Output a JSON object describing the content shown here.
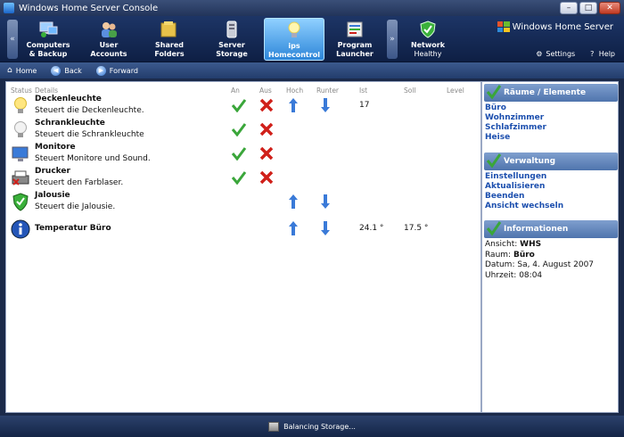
{
  "window": {
    "title": "Windows Home Server Console",
    "minimize_glyph": "–",
    "maximize_glyph": "□",
    "close_glyph": "✕"
  },
  "nav": {
    "left_arrow": "«",
    "right_arrow": "»",
    "tabs": [
      {
        "line1": "Computers",
        "line2": "& Backup",
        "icon": "computers-icon"
      },
      {
        "line1": "User",
        "line2": "Accounts",
        "icon": "user-accounts-icon"
      },
      {
        "line1": "Shared",
        "line2": "Folders",
        "icon": "shared-folders-icon"
      },
      {
        "line1": "Server",
        "line2": "Storage",
        "icon": "server-storage-icon"
      },
      {
        "line1": "ips",
        "line2": "Homecontrol",
        "icon": "lightbulb-icon",
        "active": true
      },
      {
        "line1": "Program",
        "line2": "Launcher",
        "icon": "program-launcher-icon"
      },
      {
        "line1": "Network",
        "line2": "Healthy",
        "icon": "network-shield-icon"
      }
    ],
    "brand": "Windows Home Server",
    "settings_label": "Settings",
    "help_label": "Help"
  },
  "toolbar": {
    "home_label": "Home",
    "back_label": "Back",
    "forward_label": "Forward"
  },
  "table": {
    "headers": {
      "status": "Status",
      "details": "Details",
      "an": "An",
      "aus": "Aus",
      "hoch": "Hoch",
      "runter": "Runter",
      "ist": "Ist",
      "soll": "Soll",
      "level": "Level"
    },
    "rows": [
      {
        "name": "Deckenleuchte",
        "desc": "Steuert die Deckenleuchte.",
        "icon": "bulb-on-icon",
        "an": true,
        "aus": true,
        "hoch": true,
        "runter": true,
        "ist": "17",
        "soll": ""
      },
      {
        "name": "Schrankleuchte",
        "desc": "Steuert die Schrankleuchte",
        "icon": "bulb-off-icon",
        "an": true,
        "aus": true,
        "hoch": false,
        "runter": false,
        "ist": "",
        "soll": ""
      },
      {
        "name": "Monitore",
        "desc": "Steuert Monitore und Sound.",
        "icon": "monitor-icon",
        "an": true,
        "aus": true,
        "hoch": false,
        "runter": false,
        "ist": "",
        "soll": ""
      },
      {
        "name": "Drucker",
        "desc": "Steuert den Farblaser.",
        "icon": "printer-icon",
        "an": true,
        "aus": true,
        "hoch": false,
        "runter": false,
        "ist": "",
        "soll": ""
      },
      {
        "name": "Jalousie",
        "desc": "Steuert die Jalousie.",
        "icon": "shield-check-icon",
        "an": false,
        "aus": false,
        "hoch": true,
        "runter": true,
        "ist": "",
        "soll": ""
      },
      {
        "name": "Temperatur Büro",
        "desc": "",
        "icon": "info-icon",
        "an": false,
        "aus": false,
        "hoch": true,
        "runter": true,
        "ist": "24.1 °",
        "soll": "17.5 °"
      }
    ]
  },
  "panel": {
    "rooms": {
      "title": "Räume / Elemente",
      "items": [
        "Büro",
        "Wohnzimmer",
        "Schlafzimmer",
        "Heise"
      ]
    },
    "admin": {
      "title": "Verwaltung",
      "items": [
        "Einstellungen",
        "Aktualisieren",
        "Beenden",
        "Ansicht wechseln"
      ]
    },
    "info": {
      "title": "Informationen",
      "ansicht_label": "Ansicht:",
      "ansicht_value": "WHS",
      "raum_label": "Raum:",
      "raum_value": "Büro",
      "datum_label": "Datum:",
      "datum_value": "Sa, 4. August 2007",
      "uhrzeit_label": "Uhrzeit:",
      "uhrzeit_value": "08:04"
    }
  },
  "status": {
    "text": "Balancing Storage..."
  },
  "colors": {
    "check": "#3aa63a",
    "cross": "#d0201a",
    "arrow": "#3a7ad8",
    "link": "#1c4fae"
  }
}
